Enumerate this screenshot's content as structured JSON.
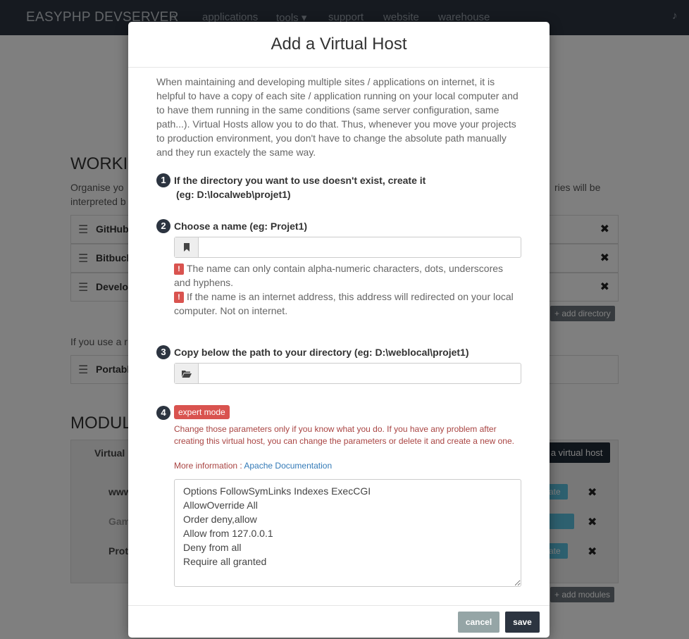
{
  "nav": {
    "brand": "EASYPHP DEVSERVER",
    "links": [
      "applications",
      "tools ▾",
      "support",
      "website",
      "warehouse"
    ]
  },
  "background": {
    "working_title": "WORKI",
    "organise_text": "Organise yo",
    "organise_text_2": "interpreted b",
    "organise_text_right": "ries will be",
    "rows": [
      "GitHub",
      "Bitbuck",
      "Develo"
    ],
    "add_directory": "+ add directory",
    "portable_text": "If you use a r",
    "portable_row": "Portabl",
    "modules_title": "MODUL",
    "virtual_label": "Virtual",
    "add_virtual_host": "d a virtual host",
    "module_items": [
      "www",
      "Gam",
      "Prot"
    ],
    "teal_labels": [
      "ate",
      "",
      "ate"
    ],
    "add_modules": "+ add modules"
  },
  "modal": {
    "title": "Add a Virtual Host",
    "intro": "When maintaining and developing multiple sites / applications on internet, it is helpful to have a copy of each site / application running on your local computer and to have them running in the same conditions (same server configuration, same path...). Virtual Hosts allow you to do that. Thus, whenever you move your projects to production environment, you don't have to change the absolute path manually and they run exactely the same way.",
    "step1": {
      "num": "1",
      "title": "If the directory you want to use doesn't exist, create it",
      "example": "(eg: D:\\localweb\\projet1)"
    },
    "step2": {
      "num": "2",
      "title": "Choose a name (eg: Projet1)",
      "value": "",
      "warnings": [
        "The name can only contain alpha-numeric characters, dots, underscores and hyphens.",
        "If the name is an internet address, this address will redirected on your local computer. Not on internet."
      ]
    },
    "step3": {
      "num": "3",
      "title": "Copy below the path to your directory (eg: D:\\weblocal\\projet1)",
      "value": ""
    },
    "step4": {
      "num": "4",
      "badge": "expert mode",
      "warning": "Change those parameters only if you know what you do. If you have any problem after creating this virtual host, you can change the parameters or delete it and create a new one.",
      "more_info_label": "More information : ",
      "more_info_link": "Apache Documentation",
      "config": "Options FollowSymLinks Indexes ExecCGI\nAllowOverride All\nOrder deny,allow\nAllow from 127.0.0.1\nDeny from all\nRequire all granted"
    },
    "cancel_label": "cancel",
    "save_label": "save"
  },
  "colors": {
    "navbar": "#2c3440",
    "danger": "#d9534f",
    "link": "#337ab7",
    "cancel": "#95a5a6"
  }
}
